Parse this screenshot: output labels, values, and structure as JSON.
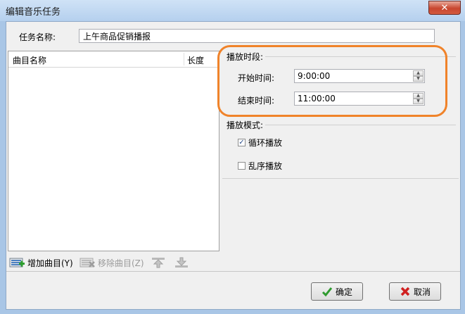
{
  "window": {
    "title": "编辑音乐任务",
    "close_glyph": "✕"
  },
  "task": {
    "name_label": "任务名称:",
    "name_value": "上午商品促销播报"
  },
  "list": {
    "col_name": "曲目名称",
    "col_length": "长度"
  },
  "toolbar": {
    "add_label": "增加曲目(Y)",
    "remove_label": "移除曲目(Z)"
  },
  "schedule": {
    "group_title": "播放时段:",
    "start_label": "开始时间:",
    "start_value": "9:00:00",
    "end_label": "结束时间:",
    "end_value": "11:00:00"
  },
  "mode": {
    "group_title": "播放模式:",
    "loop_label": "循环播放",
    "loop_checked": true,
    "shuffle_label": "乱序播放",
    "shuffle_checked": false
  },
  "buttons": {
    "ok_label": "确定",
    "cancel_label": "取消"
  },
  "colors": {
    "highlight": "#f0832a"
  }
}
